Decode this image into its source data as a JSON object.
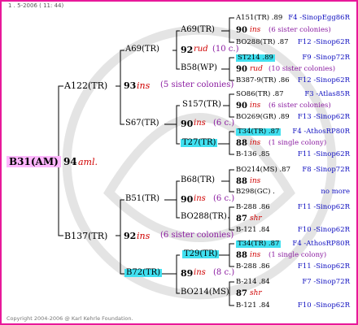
{
  "header": {
    "date": "1 . 5-2006 ( 11: 44)"
  },
  "footer": {
    "copyright": "Copyright 2004-2006 @ Karl Kehrle Foundation."
  },
  "colors": {
    "border": "#e8189a",
    "highlight": "#40e0f0",
    "root_highlight": "#ffb7ff",
    "ins_red": "#d00000",
    "link_blue": "#1010c0",
    "colonies_purple": "#8a1aa0"
  },
  "root": {
    "id": "B31(AM)",
    "num": "94",
    "type": "aml."
  },
  "gen1": [
    {
      "id": "A122(TR)",
      "num": "93",
      "type": "ins",
      "note": "(5 sister colonies)"
    },
    {
      "id": "B137(TR)",
      "num": "92",
      "type": "ins",
      "note": "(6 sister colonies)"
    }
  ],
  "gen2": [
    {
      "id": "A69(TR)",
      "num": "92",
      "type": "rud",
      "note": "(10 c.)"
    },
    {
      "id": "B58(WP)"
    },
    {
      "id": "S157(TR)",
      "num": "90",
      "type": "ins",
      "note": "(6 c.)"
    },
    {
      "id": "S67(TR)"
    },
    {
      "id": "T27(TR)"
    },
    {
      "id": "B68(TR)",
      "num": "90",
      "type": "ins",
      "note": "(6 c.)"
    },
    {
      "id": "B51(TR)"
    },
    {
      "id": "BO288(TR)"
    },
    {
      "id": "T29(TR)",
      "num": "89",
      "type": "ins",
      "note": "(8 c.)"
    },
    {
      "id": "B72(TR)"
    },
    {
      "id": "BO214(MS)"
    }
  ],
  "gen3": [
    {
      "left": "A151(TR) .89",
      "right": "F4 -SinopEgg86R"
    },
    {
      "num": "90",
      "type": "ins",
      "note": "(6 sister colonies)"
    },
    {
      "left": "BO288(TR) .87",
      "right": "F12 -Sinop62R"
    },
    {
      "left": "ST214 .89",
      "right": "F9 -Sinop72R"
    },
    {
      "num": "90",
      "type": "rud",
      "note": "(10 sister colonies)"
    },
    {
      "left": "B387-9(TR) .86",
      "right": "F12 -Sinop62R"
    },
    {
      "left": "SO86(TR) .87",
      "right": "F3 -Atlas85R"
    },
    {
      "num": "90",
      "type": "ins",
      "note": "(6 sister colonies)"
    },
    {
      "left": "BO269(GR) .89",
      "right": "F13 -Sinop62R"
    },
    {
      "left": "T34(TR) .87",
      "right": "F4 -AthosRP80R"
    },
    {
      "num": "88",
      "type": "ins",
      "note": "(1 single colony)"
    },
    {
      "left": "B-136 .85",
      "right": "F11 -Sinop62R"
    },
    {
      "left": "BO214(MS) .87",
      "right": "F8 -Sinop72R"
    },
    {
      "num": "88",
      "type": "ins",
      "note": ""
    },
    {
      "left": "B298(GC) .",
      "right": "no more"
    },
    {
      "left": "B-288 .86",
      "right": "F11 -Sinop62R"
    },
    {
      "num": "87",
      "type": "shr",
      "note": ""
    },
    {
      "left": "B-121 .84",
      "right": "F10 -Sinop62R"
    },
    {
      "left": "T34(TR) .87",
      "right": "F4 -AthosRP80R"
    },
    {
      "num": "88",
      "type": "ins",
      "note": "(1 single colony)"
    },
    {
      "left": "B-288 .86",
      "right": "F11 -Sinop62R"
    },
    {
      "left": "B-214 .84",
      "right": "F7 -Sinop72R"
    },
    {
      "num": "87",
      "type": "shr",
      "note": ""
    },
    {
      "left": "B-121 .84",
      "right": "F10 -Sinop62R"
    }
  ]
}
